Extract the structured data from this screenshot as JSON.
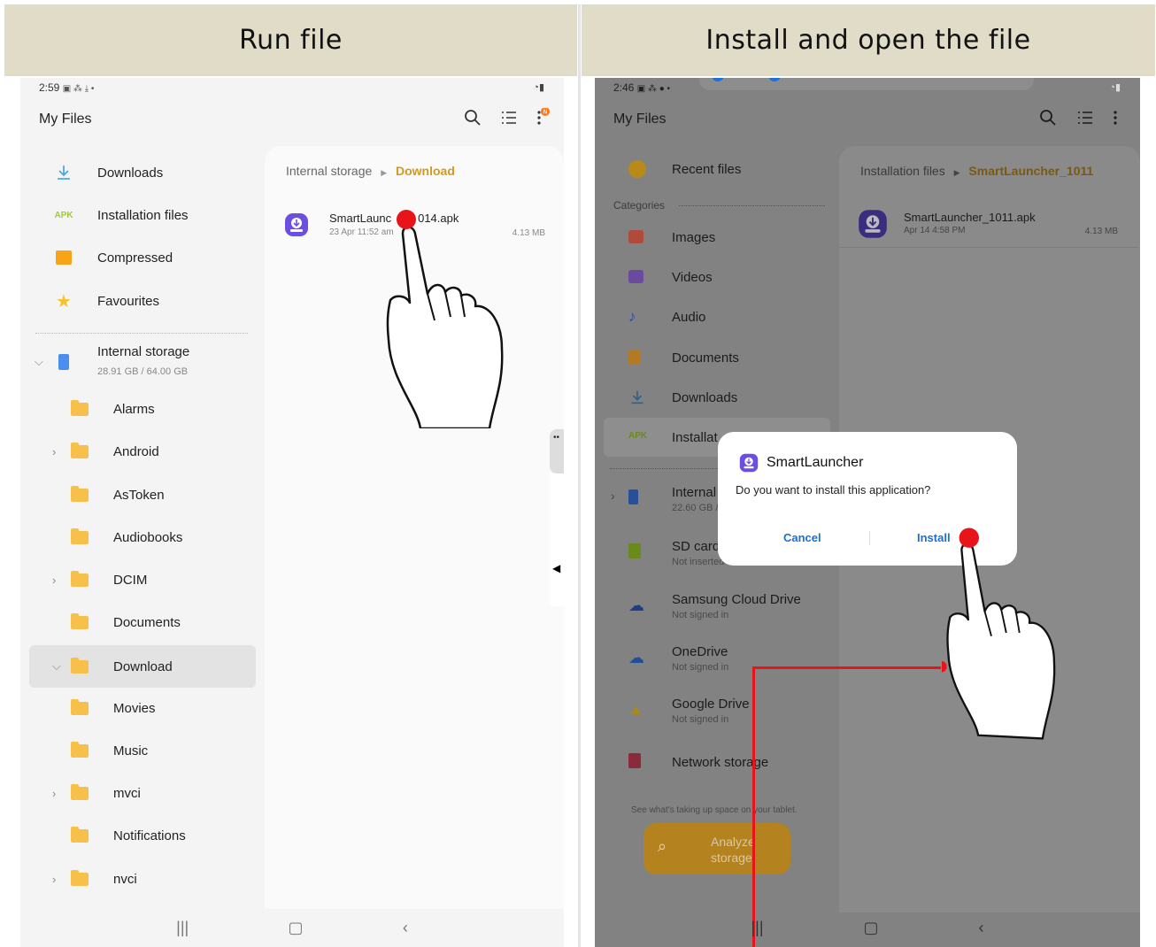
{
  "headers": {
    "left": "Run file",
    "right": "Install and open the file"
  },
  "left": {
    "status_time": "2:59",
    "app_title": "My Files",
    "sidebar": {
      "downloads": "Downloads",
      "apk_badge": "APK",
      "installation_files": "Installation files",
      "compressed": "Compressed",
      "favourites": "Favourites",
      "internal_storage": "Internal storage",
      "internal_storage_size": "28.91 GB / 64.00 GB",
      "folders": [
        "Alarms",
        "Android",
        "AsToken",
        "Audiobooks",
        "DCIM",
        "Documents",
        "Download",
        "Movies",
        "Music",
        "mvci",
        "Notifications",
        "nvci"
      ]
    },
    "breadcrumb": {
      "root": "Internal storage",
      "current": "Download"
    },
    "file": {
      "name_start": "SmartLaunc",
      "name_end": "014.apk",
      "date": "23 Apr 11:52 am",
      "size": "4.13 MB"
    }
  },
  "right": {
    "status_time": "2:46",
    "app_title": "My Files",
    "sidebar": {
      "recent_files": "Recent files",
      "categories": "Categories",
      "images": "Images",
      "videos": "Videos",
      "audio": "Audio",
      "documents": "Documents",
      "downloads": "Downloads",
      "apk_badge": "APK",
      "installation_partial": "Installat",
      "internal_partial": "Internal",
      "internal_size_partial": "22.60 GB /",
      "sd_partial": "SD card",
      "sd_sub_partial": "Not inserted",
      "samsung_cloud": "Samsung Cloud Drive",
      "samsung_cloud_sub": "Not signed in",
      "onedrive": "OneDrive",
      "onedrive_sub": "Not signed in",
      "google_drive": "Google Drive",
      "google_drive_sub": "Not signed in",
      "network_storage": "Network storage",
      "analyze_hint": "See what's taking up space on your tablet.",
      "analyze_line1": "Analyze",
      "analyze_line2": "storage"
    },
    "breadcrumb": {
      "root": "Installation files",
      "current": "SmartLauncher_1011"
    },
    "file": {
      "name": "SmartLauncher_1011.apk",
      "date": "Apr 14 4:58 PM",
      "size": "4.13 MB"
    },
    "dialog": {
      "title": "SmartLauncher",
      "message": "Do you want to install this application?",
      "cancel": "Cancel",
      "install": "Install"
    }
  },
  "colors": {
    "header_bg": "#e0dcc7",
    "accent_orange": "#d39a1e",
    "dialog_blue": "#1d6fcf",
    "tap_red": "#e8141a"
  }
}
